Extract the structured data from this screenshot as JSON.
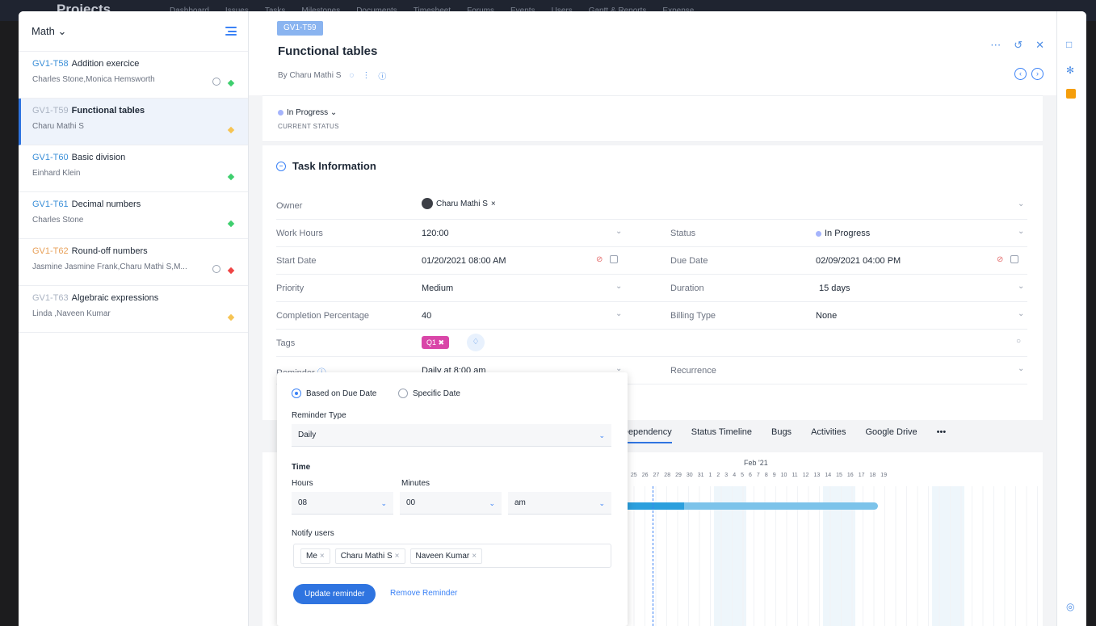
{
  "topbar": {
    "brand": "Projects",
    "nav": [
      "Dashboard",
      "Issues",
      "Tasks",
      "Milestones",
      "Documents",
      "Timesheet",
      "Forums",
      "Events",
      "Users",
      "Gantt & Reports",
      "Expense"
    ]
  },
  "sidebar": {
    "project": "Math",
    "tasks": [
      {
        "id": "GV1-T58",
        "name": "Addition exercice",
        "owners": "Charles Stone,Monica Hemsworth",
        "priority_color": "#3ecf6e",
        "clock": true,
        "id_style": "blue"
      },
      {
        "id": "GV1-T59",
        "name": "Functional tables",
        "owners": "Charu Mathi S",
        "priority_color": "#f6c453",
        "clock": false,
        "id_style": "grey",
        "active": true
      },
      {
        "id": "GV1-T60",
        "name": "Basic division",
        "owners": "Einhard Klein",
        "priority_color": "#3ecf6e",
        "clock": false,
        "id_style": "blue"
      },
      {
        "id": "GV1-T61",
        "name": "Decimal numbers",
        "owners": "Charles Stone",
        "priority_color": "#3ecf6e",
        "clock": false,
        "id_style": "blue"
      },
      {
        "id": "GV1-T62",
        "name": "Round-off numbers",
        "owners": "Jasmine Jasmine Frank,Charu Mathi S,M...",
        "priority_color": "#ef4444",
        "clock": true,
        "id_style": "orange"
      },
      {
        "id": "GV1-T63",
        "name": "Algebraic expressions",
        "owners": "Linda ,Naveen Kumar",
        "priority_color": "#f6c453",
        "clock": false,
        "id_style": "grey"
      }
    ]
  },
  "detail": {
    "id_chip": "GV1-T59",
    "title": "Functional tables",
    "byline": "By Charu Mathi S",
    "status_value": "In Progress",
    "status_label": "CURRENT STATUS",
    "section_title": "Task Information",
    "owner_label": "Owner",
    "owner_value": "Charu Mathi S",
    "work_hours_label": "Work Hours",
    "work_hours": "120:00",
    "status_label2": "Status",
    "status2": "In Progress",
    "start_label": "Start Date",
    "start_date": "01/20/2021 08:00 AM",
    "due_label": "Due Date",
    "due_date": "02/09/2021 04:00 PM",
    "priority_label": "Priority",
    "priority": "Medium",
    "duration_label": "Duration",
    "duration": "15  days",
    "completion_label": "Completion Percentage",
    "completion": "40",
    "billing_label": "Billing Type",
    "billing": "None",
    "tags_label": "Tags",
    "tag": "Q1",
    "reminder_label": "Reminder",
    "reminder": "Daily at 8:00 am",
    "recurrence_label": "Recurrence"
  },
  "tabs": [
    "Dependency",
    "Status Timeline",
    "Bugs",
    "Activities",
    "Google Drive",
    "•••"
  ],
  "gantt": {
    "month": "Feb '21",
    "days": [
      "4",
      "25",
      "26",
      "27",
      "28",
      "29",
      "30",
      "31",
      "1",
      "2",
      "3",
      "4",
      "5",
      "6",
      "7",
      "8",
      "9",
      "10",
      "11",
      "12",
      "13",
      "14",
      "15",
      "16",
      "17",
      "18",
      "19"
    ],
    "progress": 0.24
  },
  "reminder_popup": {
    "option_due": "Based on Due Date",
    "option_specific": "Specific Date",
    "type_label": "Reminder Type",
    "type_value": "Daily",
    "time_label": "Time",
    "hours_label": "Hours",
    "minutes_label": "Minutes",
    "hours_value": "08",
    "minutes_value": "00",
    "ampm_value": "am",
    "notify_label": "Notify users",
    "users": [
      "Me",
      "Charu Mathi S",
      "Naveen Kumar"
    ],
    "update_btn": "Update reminder",
    "remove_btn": "Remove Reminder"
  },
  "colors": {
    "accent": "#2f74e0",
    "tag": "#d946a8"
  }
}
